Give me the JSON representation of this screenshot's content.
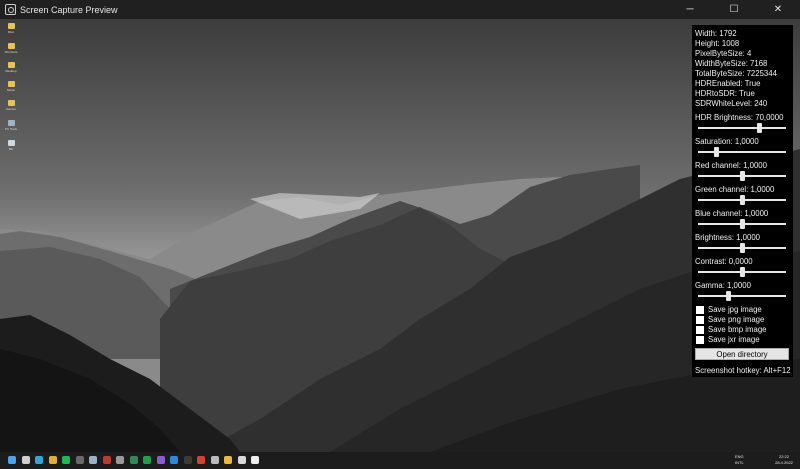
{
  "window": {
    "title": "Screen Capture Preview",
    "minimize_glyph": "─",
    "maximize_glyph": "☐",
    "close_glyph": "✕"
  },
  "desktop_icons": [
    {
      "label": "Misc",
      "icon": "folder-icon"
    },
    {
      "label": "Shortcuts",
      "icon": "folder-icon"
    },
    {
      "label": "Desktop",
      "icon": "folder-icon"
    },
    {
      "label": "Music",
      "icon": "folder-icon"
    },
    {
      "label": "Games",
      "icon": "folder-icon"
    },
    {
      "label": "PC Tools",
      "icon": "app-icon"
    },
    {
      "label": "Bin",
      "icon": "recycle-bin-icon"
    }
  ],
  "panel": {
    "info": [
      "Width: 1792",
      "Height: 1008",
      "PixelByteSize: 4",
      "WidthByteSize: 7168",
      "TotalByteSize: 7225344",
      "HDREnabled: True",
      "HDRtoSDR: True",
      "SDRWhiteLevel: 240"
    ],
    "sliders": [
      {
        "label": "HDR Brightness: 70,0000",
        "level": 0.69
      },
      {
        "label": "Saturation: 1,0000",
        "level": 0.21
      },
      {
        "label": "Red channel: 1,0000",
        "level": 0.5
      },
      {
        "label": "Green channel: 1,0000",
        "level": 0.5
      },
      {
        "label": "Blue channel: 1,0000",
        "level": 0.5
      },
      {
        "label": "Brightness: 1,0000",
        "level": 0.5
      },
      {
        "label": "Contrast: 0,0000",
        "level": 0.5
      },
      {
        "label": "Gamma: 1,0000",
        "level": 0.34
      }
    ],
    "checkboxes": [
      {
        "label": "Save jpg image",
        "checked": false
      },
      {
        "label": "Save png image",
        "checked": false
      },
      {
        "label": "Save bmp image",
        "checked": false
      },
      {
        "label": "Save jxr image",
        "checked": false
      }
    ],
    "open_button": "Open directory",
    "hotkey": "Screenshot hotkey: Alt+F12"
  },
  "taskbar": {
    "lang_1": "ENG",
    "lang_2": "INTL",
    "time": "22:22",
    "date": "28.4.2022",
    "apps": [
      {
        "name": "start-icon",
        "color": "#4aa3f0"
      },
      {
        "name": "search-icon",
        "color": "#cfcfcf"
      },
      {
        "name": "edge-icon",
        "color": "#2fa7d8"
      },
      {
        "name": "chrome-icon",
        "color": "#e0b030"
      },
      {
        "name": "spotify-icon",
        "color": "#1db954"
      },
      {
        "name": "app-icon",
        "color": "#6a6a6a"
      },
      {
        "name": "steam-icon",
        "color": "#9bb0c8"
      },
      {
        "name": "app-icon",
        "color": "#c0392b"
      },
      {
        "name": "app-icon",
        "color": "#9a9a9a"
      },
      {
        "name": "app-icon",
        "color": "#2e8b57"
      },
      {
        "name": "xbox-icon",
        "color": "#1fa14a"
      },
      {
        "name": "visual-studio-icon",
        "color": "#8e5bd0"
      },
      {
        "name": "vscode-icon",
        "color": "#2a8ae0"
      },
      {
        "name": "app-icon",
        "color": "#3a3a3a"
      },
      {
        "name": "app-icon",
        "color": "#d4432e"
      },
      {
        "name": "app-icon",
        "color": "#bbbbbb"
      },
      {
        "name": "file-explorer-icon",
        "color": "#e8b93a"
      },
      {
        "name": "app-icon",
        "color": "#d8d8d8"
      },
      {
        "name": "screen-capture-icon",
        "color": "#eeeeee"
      }
    ]
  }
}
